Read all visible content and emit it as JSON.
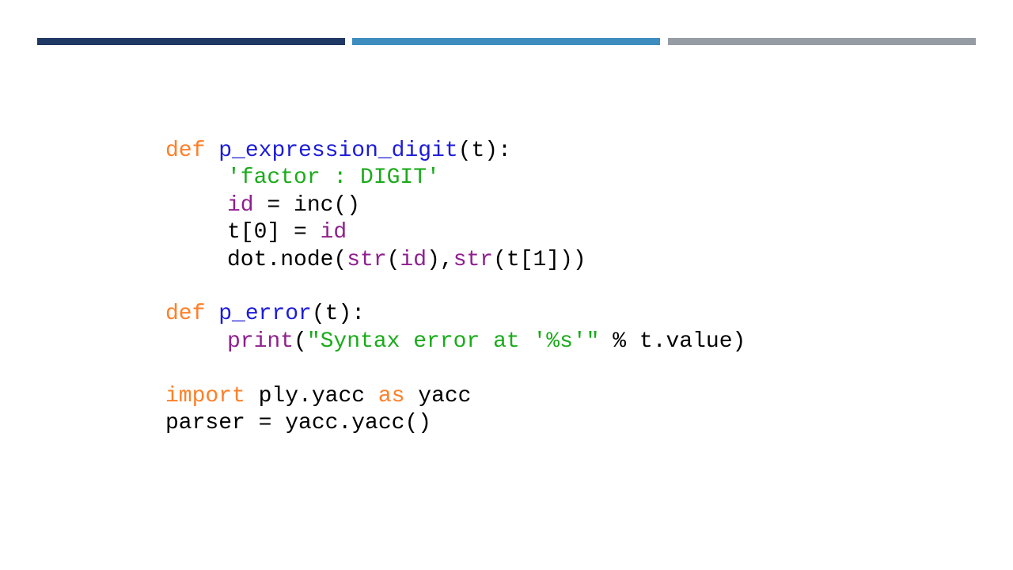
{
  "colors": {
    "bar_1": "#1f3864",
    "bar_2": "#3e8dbf",
    "bar_3": "#969ca4",
    "keyword": "#ff7f27",
    "function": "#1c1cd9",
    "builtin": "#8f1f8f",
    "string": "#1aab1a",
    "plain": "#000000"
  },
  "code": {
    "l1": {
      "kw": "def",
      "space": " ",
      "fn": "p_expression_digit",
      "rest": "(t):"
    },
    "l2": {
      "str": "'factor : DIGIT'"
    },
    "l3": {
      "builtin": "id",
      "rest": " = inc()"
    },
    "l4": {
      "pre": "t[0] = ",
      "builtin": "id"
    },
    "l5": {
      "pre": "dot.node(",
      "b1": "str",
      "p1": "(",
      "b2": "id",
      "p2": "),",
      "b3": "str",
      "p3": "(t[1]))"
    },
    "l7": {
      "kw": "def",
      "space": " ",
      "fn": "p_error",
      "rest": "(t):"
    },
    "l8": {
      "builtin": "print",
      "p1": "(",
      "str": "\"Syntax error at '%s'\"",
      "rest": " % t.value)"
    },
    "l10": {
      "kw1": "import",
      "mid": " ply.yacc ",
      "kw2": "as",
      "rest": " yacc"
    },
    "l11": {
      "text": "parser = yacc.yacc()"
    }
  }
}
